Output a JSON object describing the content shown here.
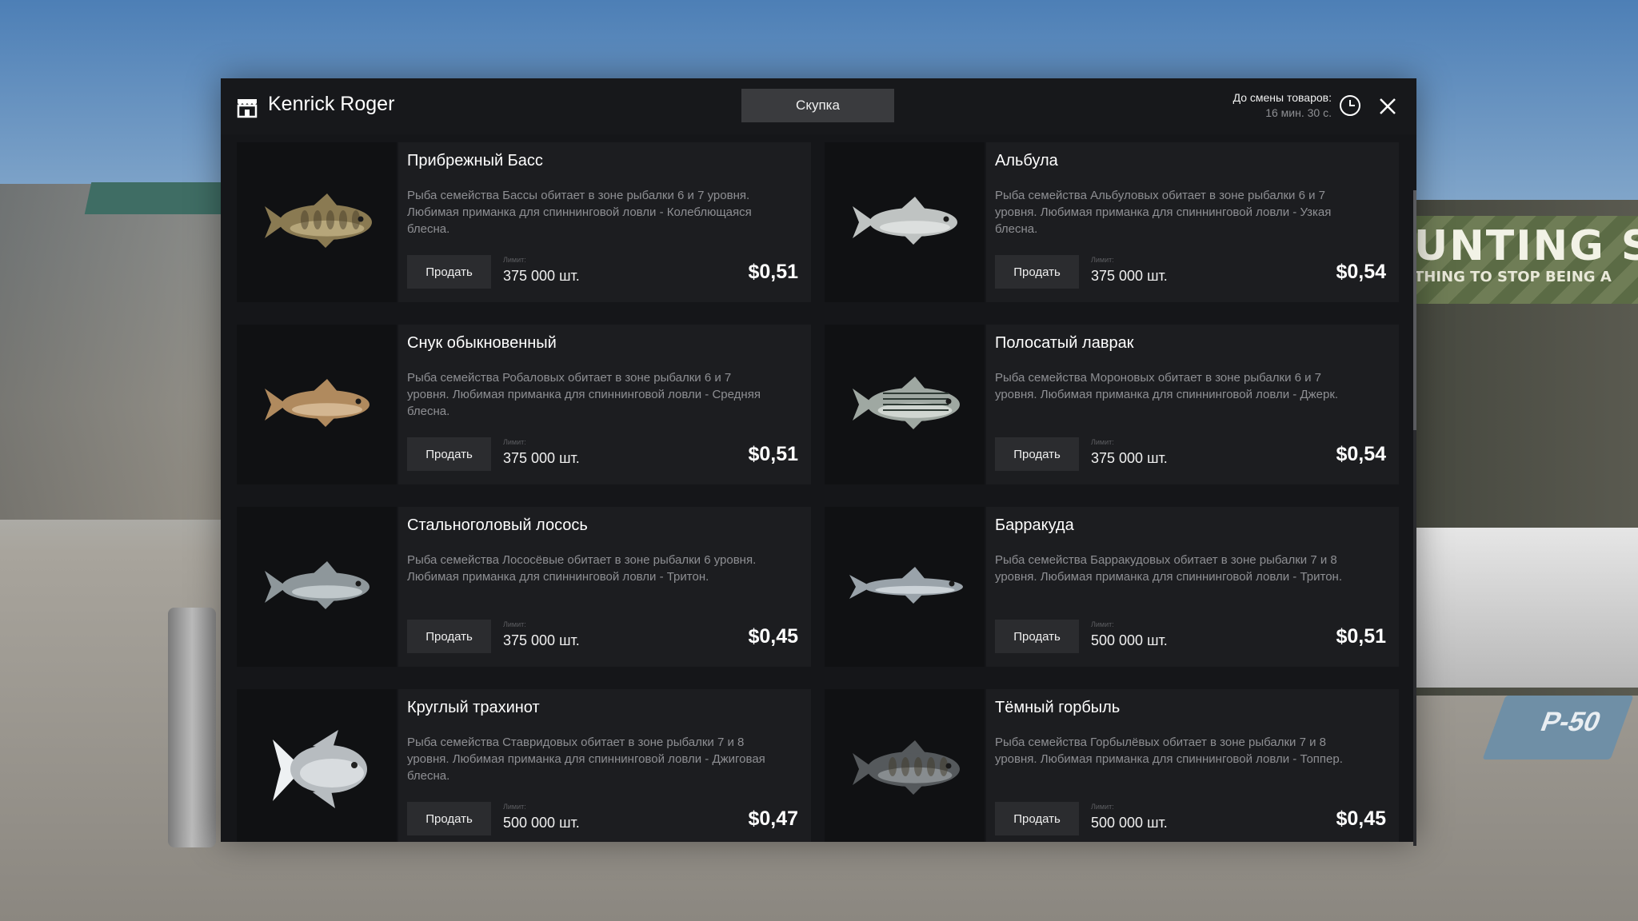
{
  "window": {
    "shop_name": "Kenrick Roger",
    "tab_label": "Скупка"
  },
  "timer": {
    "label": "До смены товаров:",
    "value": "16 мин. 30 с."
  },
  "background": {
    "sign_title": "UNTING S",
    "sign_subtitle": "THING TO STOP BEING A",
    "parking": "P-50"
  },
  "card_labels": {
    "sell": "Продать",
    "limit": "Лимит:"
  },
  "fish": [
    {
      "name": "Прибрежный Басс",
      "desc": "Рыба семейства Бассы обитает в зоне рыбалки 6 и 7 уровня. Любимая приманка для спиннинговой ловли - Колеблющаяся блесна.",
      "limit": "375 000 шт.",
      "price": "$0,51",
      "body_color": "#8a7a52",
      "accent": "#c9b98b",
      "shape": "bass"
    },
    {
      "name": "Альбула",
      "desc": "Рыба семейства Альбуловых обитает в зоне рыбалки 6 и 7 уровня. Любимая приманка для спиннинговой ловли - Узкая блесна.",
      "limit": "375 000 шт.",
      "price": "$0,54",
      "body_color": "#bfc3c2",
      "accent": "#e8ebea",
      "shape": "slim"
    },
    {
      "name": "Снук обыкновенный",
      "desc": "Рыба семейства Робаловых обитает в зоне рыбалки 6 и 7 уровня. Любимая приманка для спиннинговой ловли - Средняя блесна.",
      "limit": "375 000 шт.",
      "price": "$0,51",
      "body_color": "#b08a5e",
      "accent": "#e2c9a6",
      "shape": "slim"
    },
    {
      "name": "Полосатый лаврак",
      "desc": "Рыба семейства Мороновых обитает в зоне рыбалки 6 и 7 уровня. Любимая приманка для спиннинговой ловли - Джерк.",
      "limit": "375 000 шт.",
      "price": "$0,54",
      "body_color": "#9fa8a2",
      "accent": "#e6eae6",
      "shape": "striped"
    },
    {
      "name": "Стальноголовый лосось",
      "desc": "Рыба семейства Лососёвые обитает в зоне рыбалки 6 уровня. Любимая приманка для спиннинговой ловли - Тритон.",
      "limit": "375 000 шт.",
      "price": "$0,45",
      "body_color": "#8e979b",
      "accent": "#d6dde0",
      "shape": "slim"
    },
    {
      "name": "Барракуда",
      "desc": "Рыба семейства Барракудовых обитает в зоне рыбалки 7 и 8 уровня. Любимая приманка для спиннинговой ловли - Тритон.",
      "limit": "500 000 шт.",
      "price": "$0,51",
      "body_color": "#9aa3aa",
      "accent": "#dfe5ea",
      "shape": "long"
    },
    {
      "name": "Круглый трахинот",
      "desc": "Рыба семейства Ставридовых обитает в зоне рыбалки 7 и 8 уровня. Любимая приманка для спиннинговой ловли - Джиговая блесна.",
      "limit": "500 000 шт.",
      "price": "$0,47",
      "body_color": "#b7bcc0",
      "accent": "#eef1f3",
      "shape": "pompano"
    },
    {
      "name": "Тёмный горбыль",
      "desc": "Рыба семейства Горбылёвых обитает в зоне рыбалки 7 и 8 уровня. Любимая приманка для спиннинговой ловли - Топпер.",
      "limit": "500 000 шт.",
      "price": "$0,45",
      "body_color": "#55595c",
      "accent": "#9da2a5",
      "shape": "bass"
    }
  ]
}
